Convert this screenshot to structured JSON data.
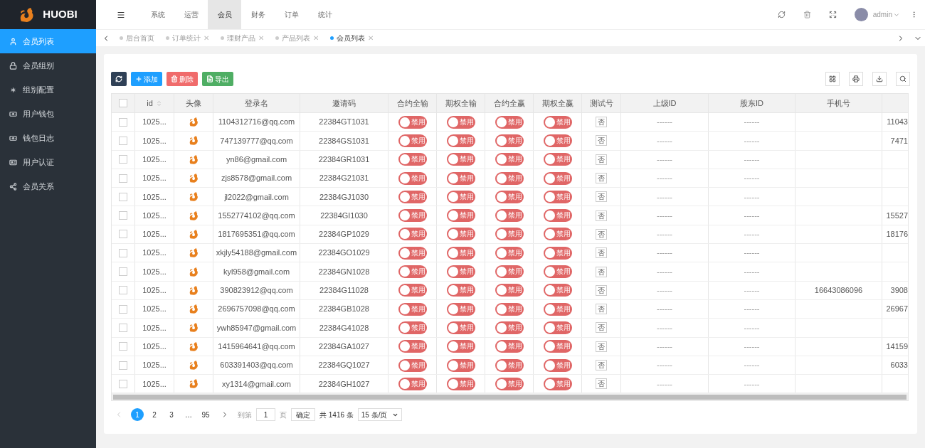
{
  "brand": "HUOBI",
  "top_menu": [
    {
      "label": "系统",
      "selected": false
    },
    {
      "label": "运营",
      "selected": false
    },
    {
      "label": "会员",
      "selected": true
    },
    {
      "label": "财务",
      "selected": false
    },
    {
      "label": "订单",
      "selected": false
    },
    {
      "label": "统计",
      "selected": false
    }
  ],
  "user": {
    "name": "admin"
  },
  "sidebar": {
    "items": [
      {
        "label": "会员列表",
        "selected": true
      },
      {
        "label": "会员组别",
        "selected": false
      },
      {
        "label": "组别配置",
        "selected": false
      },
      {
        "label": "用户钱包",
        "selected": false
      },
      {
        "label": "钱包日志",
        "selected": false
      },
      {
        "label": "用户认证",
        "selected": false
      },
      {
        "label": "会员关系",
        "selected": false
      }
    ]
  },
  "page_tabs": [
    {
      "label": "后台首页",
      "selected": false
    },
    {
      "label": "订单统计",
      "close": "✕",
      "selected": false
    },
    {
      "label": "理财产品",
      "close": "✕",
      "selected": false
    },
    {
      "label": "产品列表",
      "close": "✕",
      "selected": false
    },
    {
      "label": "会员列表",
      "close": "✕",
      "selected": true
    }
  ],
  "toolbar": {
    "buttons": [
      {
        "kind": "refresh"
      },
      {
        "kind": "add",
        "label": "添加"
      },
      {
        "kind": "delete",
        "label": "删除"
      },
      {
        "kind": "export",
        "label": "导出"
      }
    ]
  },
  "table": {
    "select_all": {
      "checked": false
    },
    "columns": [
      "id",
      "头像",
      "登录名",
      "邀请码",
      "合约全输",
      "期权全输",
      "合约全赢",
      "期权全赢",
      "测试号",
      "上级ID",
      "股东ID",
      "手机号"
    ],
    "rows": [
      {
        "checked": false,
        "id": "1025...",
        "login": "1104312716@qq.com",
        "invite": "22384GT1031",
        "toggles": [
          {
            "label": "禁用",
            "on": false
          },
          {
            "label": "禁用",
            "on": false
          },
          {
            "label": "禁用",
            "on": false
          },
          {
            "label": "禁用",
            "on": false
          }
        ],
        "test": "否",
        "parent_id": "------",
        "holder_id": "------",
        "column_13": "11043"
      },
      {
        "checked": false,
        "id": "1025...",
        "login": "747139777@qq.com",
        "invite": "22384GS1031",
        "toggles": [
          {
            "label": "禁用",
            "on": false
          },
          {
            "label": "禁用",
            "on": false
          },
          {
            "label": "禁用",
            "on": false
          },
          {
            "label": "禁用",
            "on": false
          }
        ],
        "test": "否",
        "parent_id": "------",
        "holder_id": "------",
        "column_13": "7471"
      },
      {
        "checked": false,
        "id": "1025...",
        "login": "yn86@gmail.com",
        "invite": "22384GR1031",
        "toggles": [
          {
            "label": "禁用",
            "on": false
          },
          {
            "label": "禁用",
            "on": false
          },
          {
            "label": "禁用",
            "on": false
          },
          {
            "label": "禁用",
            "on": false
          }
        ],
        "test": "否",
        "parent_id": "------",
        "holder_id": "------"
      },
      {
        "checked": false,
        "id": "1025...",
        "login": "zjs8578@gmail.com",
        "invite": "22384G21031",
        "toggles": [
          {
            "label": "禁用",
            "on": false
          },
          {
            "label": "禁用",
            "on": false
          },
          {
            "label": "禁用",
            "on": false
          },
          {
            "label": "禁用",
            "on": false
          }
        ],
        "test": "否",
        "parent_id": "------",
        "holder_id": "------"
      },
      {
        "checked": false,
        "id": "1025...",
        "login": "jl2022@gmail.com",
        "invite": "22384GJ1030",
        "toggles": [
          {
            "label": "禁用",
            "on": false
          },
          {
            "label": "禁用",
            "on": false
          },
          {
            "label": "禁用",
            "on": false
          },
          {
            "label": "禁用",
            "on": false
          }
        ],
        "test": "否",
        "parent_id": "------",
        "holder_id": "------"
      },
      {
        "checked": false,
        "id": "1025...",
        "login": "1552774102@qq.com",
        "invite": "22384GI1030",
        "toggles": [
          {
            "label": "禁用",
            "on": false
          },
          {
            "label": "禁用",
            "on": false
          },
          {
            "label": "禁用",
            "on": false
          },
          {
            "label": "禁用",
            "on": false
          }
        ],
        "test": "否",
        "parent_id": "------",
        "holder_id": "------",
        "column_13": "15527"
      },
      {
        "checked": false,
        "id": "1025...",
        "login": "1817695351@qq.com",
        "invite": "22384GP1029",
        "toggles": [
          {
            "label": "禁用",
            "on": false
          },
          {
            "label": "禁用",
            "on": false
          },
          {
            "label": "禁用",
            "on": false
          },
          {
            "label": "禁用",
            "on": false
          }
        ],
        "test": "否",
        "parent_id": "------",
        "holder_id": "------",
        "column_13": "18176"
      },
      {
        "checked": false,
        "id": "1025...",
        "login": "xkjly54188@gmail.com",
        "invite": "22384GO1029",
        "toggles": [
          {
            "label": "禁用",
            "on": false
          },
          {
            "label": "禁用",
            "on": false
          },
          {
            "label": "禁用",
            "on": false
          },
          {
            "label": "禁用",
            "on": false
          }
        ],
        "test": "否",
        "parent_id": "------",
        "holder_id": "------"
      },
      {
        "checked": false,
        "id": "1025...",
        "login": "kyl958@gmail.com",
        "invite": "22384GN1028",
        "toggles": [
          {
            "label": "禁用",
            "on": false
          },
          {
            "label": "禁用",
            "on": false
          },
          {
            "label": "禁用",
            "on": false
          },
          {
            "label": "禁用",
            "on": false
          }
        ],
        "test": "否",
        "parent_id": "------",
        "holder_id": "------"
      },
      {
        "checked": false,
        "id": "1025...",
        "login": "390823912@qq.com",
        "invite": "22384G11028",
        "toggles": [
          {
            "label": "禁用",
            "on": false
          },
          {
            "label": "禁用",
            "on": false
          },
          {
            "label": "禁用",
            "on": false
          },
          {
            "label": "禁用",
            "on": false
          }
        ],
        "test": "否",
        "parent_id": "------",
        "holder_id": "------",
        "phone": "16643086096",
        "column_13": "3908"
      },
      {
        "checked": false,
        "id": "1025...",
        "login": "2696757098@qq.com",
        "invite": "22384GB1028",
        "toggles": [
          {
            "label": "禁用",
            "on": false
          },
          {
            "label": "禁用",
            "on": false
          },
          {
            "label": "禁用",
            "on": false
          },
          {
            "label": "禁用",
            "on": false
          }
        ],
        "test": "否",
        "parent_id": "------",
        "holder_id": "------",
        "column_13": "26967"
      },
      {
        "checked": false,
        "id": "1025...",
        "login": "ywh85947@gmail.com",
        "invite": "22384G41028",
        "toggles": [
          {
            "label": "禁用",
            "on": false
          },
          {
            "label": "禁用",
            "on": false
          },
          {
            "label": "禁用",
            "on": false
          },
          {
            "label": "禁用",
            "on": false
          }
        ],
        "test": "否",
        "parent_id": "------",
        "holder_id": "------"
      },
      {
        "checked": false,
        "id": "1025...",
        "login": "1415964641@qq.com",
        "invite": "22384GA1027",
        "toggles": [
          {
            "label": "禁用",
            "on": false
          },
          {
            "label": "禁用",
            "on": false
          },
          {
            "label": "禁用",
            "on": false
          },
          {
            "label": "禁用",
            "on": false
          }
        ],
        "test": "否",
        "parent_id": "------",
        "holder_id": "------",
        "column_13": "14159"
      },
      {
        "checked": false,
        "id": "1025...",
        "login": "603391403@qq.com",
        "invite": "22384GQ1027",
        "toggles": [
          {
            "label": "禁用",
            "on": false
          },
          {
            "label": "禁用",
            "on": false
          },
          {
            "label": "禁用",
            "on": false
          },
          {
            "label": "禁用",
            "on": false
          }
        ],
        "test": "否",
        "parent_id": "------",
        "holder_id": "------",
        "column_13": "6033"
      },
      {
        "checked": false,
        "id": "1025...",
        "login": "xy1314@gmail.com",
        "invite": "22384GH1027",
        "toggles": [
          {
            "label": "禁用",
            "on": false
          },
          {
            "label": "禁用",
            "on": false
          },
          {
            "label": "禁用",
            "on": false
          },
          {
            "label": "禁用",
            "on": false
          }
        ],
        "test": "否",
        "parent_id": "------",
        "holder_id": "------"
      }
    ]
  },
  "pagination": {
    "pages": [
      {
        "label": "1",
        "selected": true
      },
      {
        "label": "2",
        "selected": false
      },
      {
        "label": "3",
        "selected": false
      },
      {
        "label": "…",
        "selected": false
      },
      {
        "label": "95",
        "selected": false
      }
    ],
    "goto_label": "到第",
    "goto_value": "1",
    "page_unit": "页",
    "confirm": "确定",
    "total": "共 1416 条",
    "page_size": "15 条/页"
  }
}
